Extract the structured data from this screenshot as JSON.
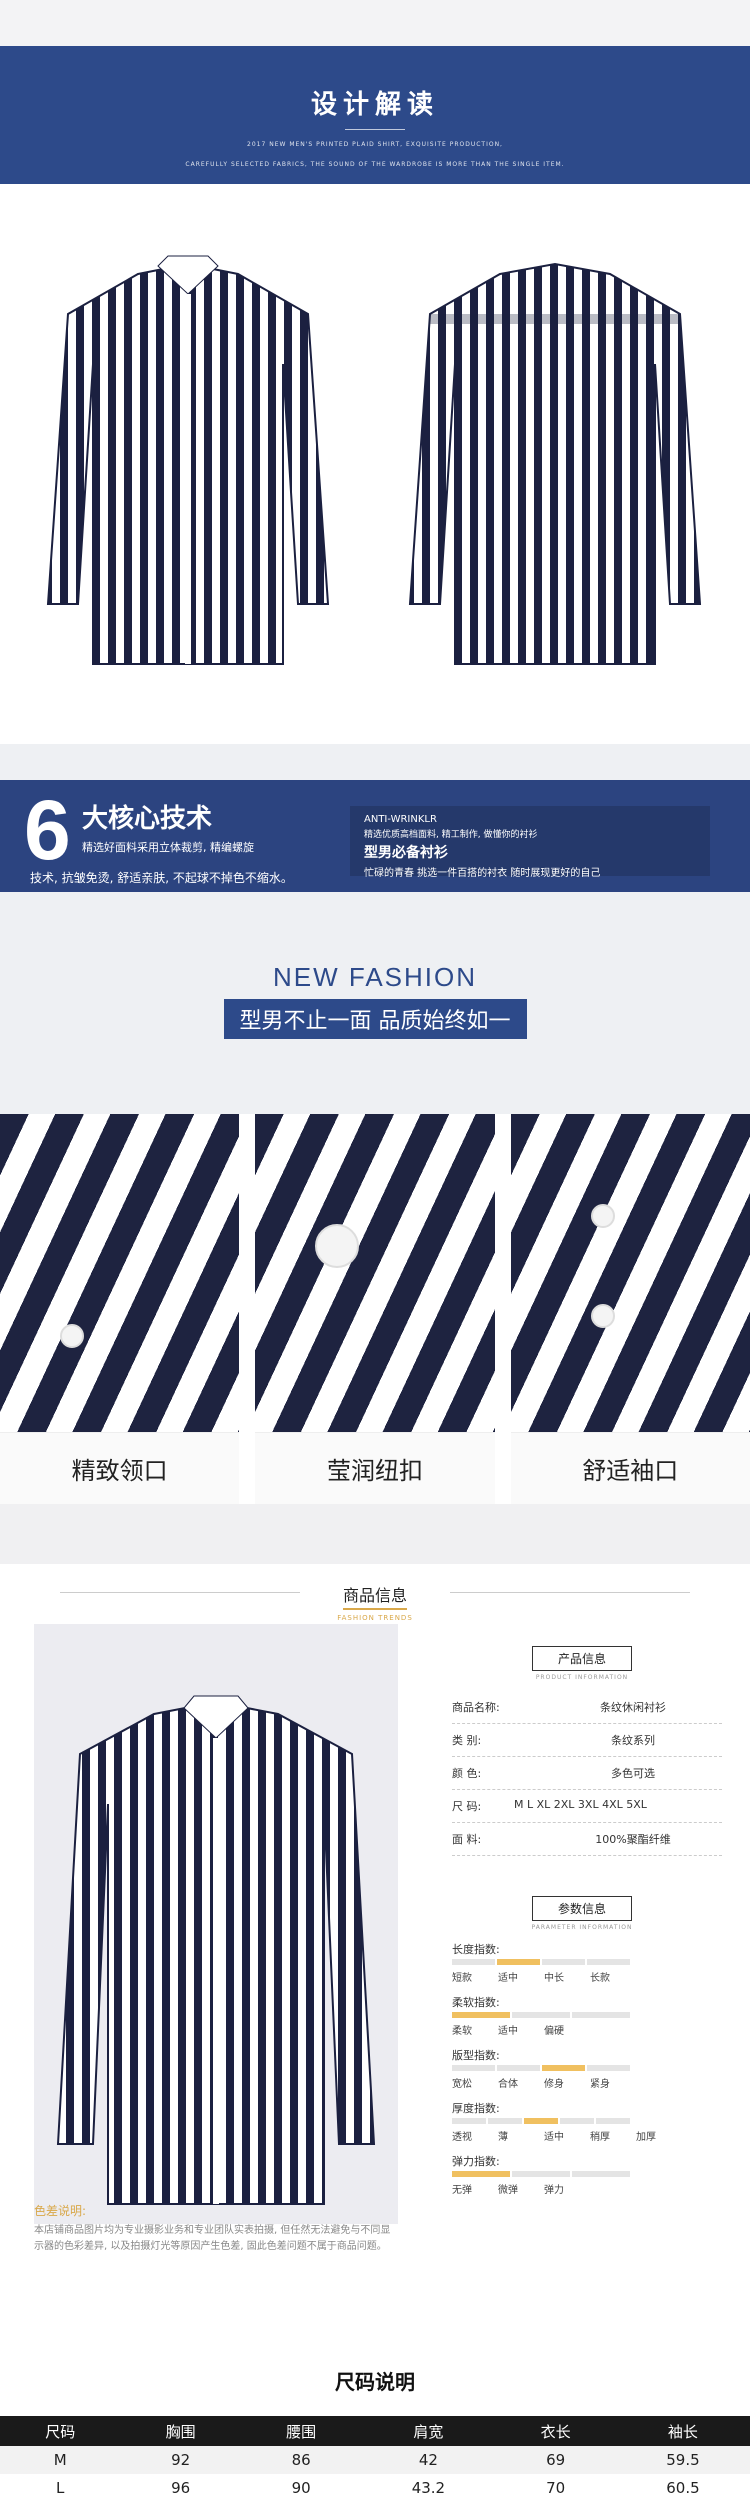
{
  "banner": {
    "title": "设计解读",
    "subtitle_line1": "2017 NEW MEN'S PRINTED PLAID SHIRT, EXQUISITE PRODUCTION,",
    "subtitle_line2": "CAREFULLY SELECTED FABRICS, THE SOUND OF THE WARDROBE IS MORE THAN THE SINGLE ITEM."
  },
  "tech": {
    "number": "6",
    "title": "大核心技术",
    "line1": "精选好面料采用立体裁剪, 精编螺旋",
    "line2": "技术, 抗皱免烫, 舒适亲肤, 不起球不掉色不缩水。",
    "eng": "ANTI-WRINKLR",
    "r1": "精选优质高档面料, 精工制作, 做懂你的衬衫",
    "r2": "型男必备衬衫",
    "r3": "忙碌的青春 挑选一件百搭的衬衣 随时展现更好的自己"
  },
  "fashion": {
    "title": "NEW FASHION",
    "tag": "型男不止一面 品质始终如一"
  },
  "details": [
    {
      "caption": "精致领口"
    },
    {
      "caption": "莹润纽扣"
    },
    {
      "caption": "舒适袖口"
    }
  ],
  "product_info": {
    "section_title": "商品信息",
    "section_sub": "FASHION TRENDS",
    "box_title": "产品信息",
    "box_sub": "PRODUCT INFORMATION",
    "rows": [
      {
        "k": "商品名称:",
        "v": "条纹休闲衬衫"
      },
      {
        "k": "类    别:",
        "v": "条纹系列"
      },
      {
        "k": "颜    色:",
        "v": "多色可选"
      },
      {
        "k": "尺    码:",
        "v": "M   L   XL   2XL   3XL   4XL   5XL"
      },
      {
        "k": "面    料:",
        "v": "100%聚酯纤维"
      }
    ],
    "param_title": "参数信息",
    "param_sub": "PARAMETER INFORMATION",
    "params": [
      {
        "k": "长度指数:",
        "opts": [
          "短款",
          "适中",
          "中长",
          "长款"
        ],
        "on": 1
      },
      {
        "k": "柔软指数:",
        "opts": [
          "柔软",
          "适中",
          "偏硬"
        ],
        "on": 0
      },
      {
        "k": "版型指数:",
        "opts": [
          "宽松",
          "合体",
          "修身",
          "紧身"
        ],
        "on": 2
      },
      {
        "k": "厚度指数:",
        "opts": [
          "透视",
          "薄",
          "适中",
          "稍厚",
          "加厚"
        ],
        "on": 2
      },
      {
        "k": "弹力指数:",
        "opts": [
          "无弹",
          "微弹",
          "弹力"
        ],
        "on": 0
      }
    ],
    "color_note_title": "色差说明:",
    "color_note_body": "本店铺商品图片均为专业摄影业务和专业团队实表拍摄, 但任然无法避免与不同显示器的色彩差异, 以及拍摄灯光等原因产生色差, 固此色差问题不属于商品问题。"
  },
  "size_table": {
    "title": "尺码说明",
    "headers": [
      "尺码",
      "胸围",
      "腰围",
      "肩宽",
      "衣长",
      "袖长"
    ],
    "rows": [
      [
        "M",
        "92",
        "86",
        "42",
        "69",
        "59.5"
      ],
      [
        "L",
        "96",
        "90",
        "43.2",
        "70",
        "60.5"
      ]
    ]
  }
}
